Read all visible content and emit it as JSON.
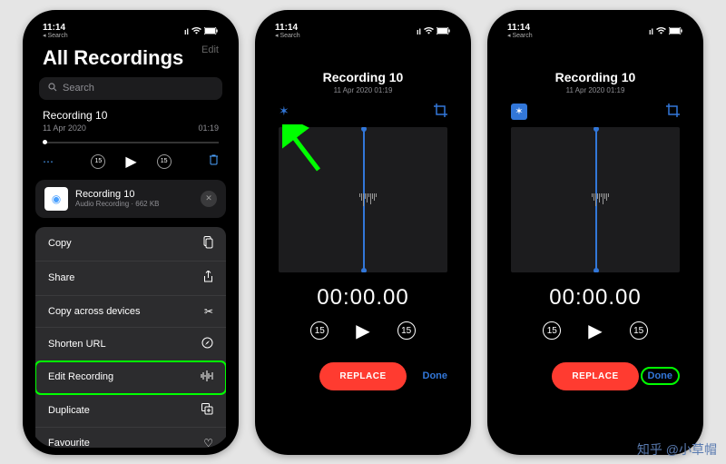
{
  "status": {
    "time": "11:14",
    "back": "Search",
    "signal": "••ıl",
    "wifi": "≈",
    "battery": "▬"
  },
  "p1": {
    "edit": "Edit",
    "title": "All Recordings",
    "search_ph": "Search",
    "rec": {
      "title": "Recording 10",
      "date": "11 Apr 2020",
      "dur": "01:19"
    },
    "skip": "15",
    "share": {
      "title": "Recording 10",
      "sub": "Audio Recording · 662 KB"
    },
    "actions": {
      "copy": "Copy",
      "share": "Share",
      "copy_across": "Copy across devices",
      "shorten": "Shorten URL",
      "edit_rec": "Edit Recording",
      "duplicate": "Duplicate",
      "favourite": "Favourite"
    }
  },
  "p2": {
    "title": "Recording 10",
    "sub": "11 Apr 2020  01:19",
    "timer": "00:00.00",
    "skip": "15",
    "replace": "REPLACE",
    "done": "Done"
  },
  "p3": {
    "title": "Recording 10",
    "sub": "11 Apr 2020  01:19",
    "timer": "00:00.00",
    "skip": "15",
    "replace": "REPLACE",
    "done": "Done"
  },
  "watermark": "知乎 @小草帽"
}
